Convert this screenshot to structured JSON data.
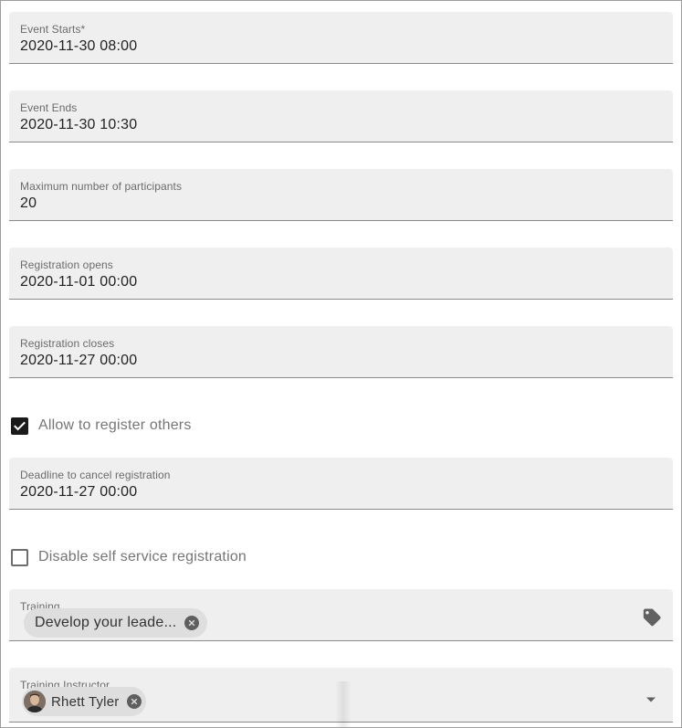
{
  "fields": {
    "event_starts": {
      "label": "Event Starts*",
      "value": "2020-11-30 08:00"
    },
    "event_ends": {
      "label": "Event Ends",
      "value": "2020-11-30 10:30"
    },
    "max_participants": {
      "label": "Maximum number of participants",
      "value": "20"
    },
    "registration_opens": {
      "label": "Registration opens",
      "value": "2020-11-01 00:00"
    },
    "registration_closes": {
      "label": "Registration closes",
      "value": "2020-11-27 00:00"
    },
    "cancel_deadline": {
      "label": "Deadline to cancel registration",
      "value": "2020-11-27 00:00"
    }
  },
  "checkboxes": {
    "allow_register_others": {
      "label": "Allow to register others",
      "checked": true
    },
    "disable_self_service": {
      "label": "Disable self service registration",
      "checked": false
    }
  },
  "training": {
    "label": "Training",
    "chip": "Develop your leade...",
    "icon": "tag-icon"
  },
  "instructor": {
    "label": "Training Instructor",
    "chip": "Rhett Tyler",
    "icon": "caret-down-icon"
  },
  "colors": {
    "field_bg": "#efefef",
    "chip_bg": "#dedede",
    "checkbox_checked": "#1a1a1a"
  }
}
